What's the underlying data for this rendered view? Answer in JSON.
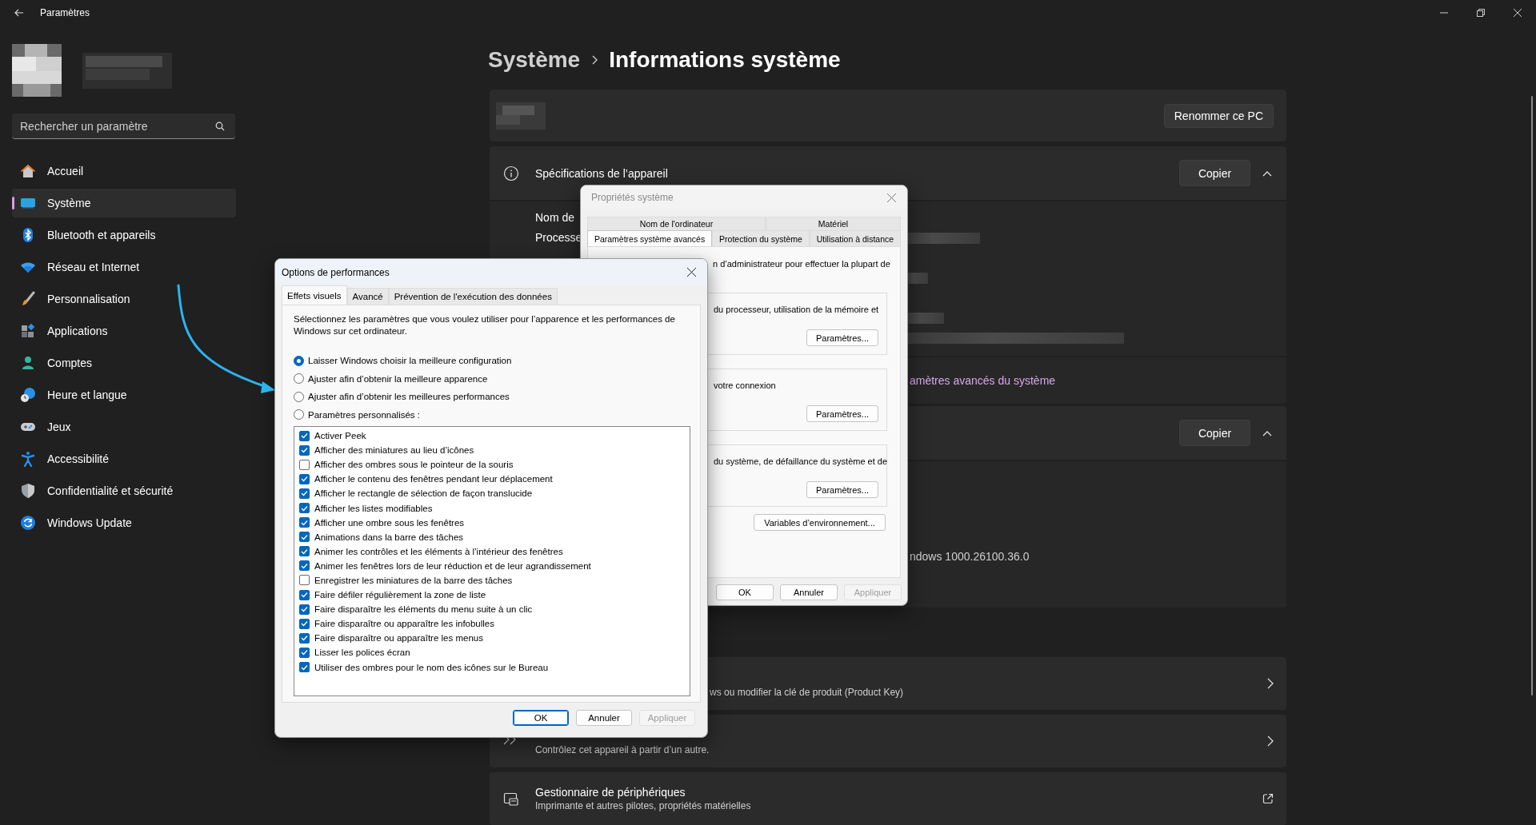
{
  "window": {
    "title": "Paramètres"
  },
  "sidebar": {
    "search": {
      "placeholder": "Rechercher un paramètre"
    },
    "items": [
      {
        "label": "Accueil",
        "selected": false
      },
      {
        "label": "Système",
        "selected": true
      },
      {
        "label": "Bluetooth et appareils",
        "selected": false
      },
      {
        "label": "Réseau et Internet",
        "selected": false
      },
      {
        "label": "Personnalisation",
        "selected": false
      },
      {
        "label": "Applications",
        "selected": false
      },
      {
        "label": "Comptes",
        "selected": false
      },
      {
        "label": "Heure et langue",
        "selected": false
      },
      {
        "label": "Jeux",
        "selected": false
      },
      {
        "label": "Accessibilité",
        "selected": false
      },
      {
        "label": "Confidentialité et sécurité",
        "selected": false
      },
      {
        "label": "Windows Update",
        "selected": false
      }
    ]
  },
  "page": {
    "breadcrumb": [
      "Système",
      "Informations système"
    ],
    "rename_button": "Renommer ce PC",
    "device_specs": {
      "title": "Spécifications de l’appareil",
      "copy_button": "Copier",
      "expanded": true,
      "rows": [
        "Nom de",
        "Processe"
      ],
      "link": "amètres avancés du système"
    },
    "windows_specs": {
      "copy_button": "Copier",
      "expanded": true,
      "version": "ndows 1000.26100.36.0"
    },
    "related": [
      {
        "kind": "chevron",
        "subtitle": "ws ou modifier la clé de produit (Product Key)"
      },
      {
        "kind": "chevron",
        "subtitle": "Contrôlez cet appareil à partir d’un autre."
      },
      {
        "kind": "external",
        "title": "Gestionnaire de périphériques",
        "subtitle": "Imprimante et autres pilotes, propriétés matérielles"
      }
    ]
  },
  "system_properties": {
    "title": "Propriétés système",
    "tab_rows": [
      [
        {
          "label": "Nom de l'ordinateur",
          "selected": false
        },
        {
          "label": "Matériel",
          "selected": false
        }
      ],
      [
        {
          "label": "Paramètres système avancés",
          "selected": true
        },
        {
          "label": "Protection du système",
          "selected": false
        },
        {
          "label": "Utilisation à distance",
          "selected": false
        }
      ]
    ],
    "intro": "n d’administrateur pour effectuer la plupart de",
    "groups": [
      {
        "text": "du processeur, utilisation de la mémoire et",
        "button": "Paramètres..."
      },
      {
        "text": "votre connexion",
        "button": "Paramètres..."
      },
      {
        "text": "du système, de défaillance du système et de",
        "button": "Paramètres..."
      }
    ],
    "env_button": "Variables d’environnement...",
    "buttons": [
      {
        "label": "OK",
        "default": false,
        "disabled": false
      },
      {
        "label": "Annuler",
        "default": false,
        "disabled": false
      },
      {
        "label": "Appliquer",
        "default": false,
        "disabled": true
      }
    ]
  },
  "performance_options": {
    "title": "Options de performances",
    "tabs": [
      {
        "label": "Effets visuels",
        "selected": true
      },
      {
        "label": "Avancé",
        "selected": false
      },
      {
        "label": "Prévention de l'exécution des données",
        "selected": false
      }
    ],
    "description": "Sélectionnez les paramètres que vous voulez utiliser pour l’apparence et les performances de Windows sur cet ordinateur.",
    "options": [
      {
        "label": "Laisser Windows choisir la meilleure configuration",
        "selected": true
      },
      {
        "label": "Ajuster afin d’obtenir la meilleure apparence",
        "selected": false
      },
      {
        "label": "Ajuster afin d’obtenir les meilleures performances",
        "selected": false
      },
      {
        "label": "Paramètres personnalisés :",
        "selected": false
      }
    ],
    "effects": [
      {
        "label": "Activer Peek",
        "checked": true
      },
      {
        "label": "Afficher des miniatures au lieu d’icônes",
        "checked": true
      },
      {
        "label": "Afficher des ombres sous le pointeur de la souris",
        "checked": false
      },
      {
        "label": "Afficher le contenu des fenêtres pendant leur déplacement",
        "checked": true
      },
      {
        "label": "Afficher le rectangle de sélection de façon translucide",
        "checked": true
      },
      {
        "label": "Afficher les listes modifiables",
        "checked": true
      },
      {
        "label": "Afficher une ombre sous les fenêtres",
        "checked": true
      },
      {
        "label": "Animations dans la barre des tâches",
        "checked": true
      },
      {
        "label": "Animer les contrôles et les éléments à l’intérieur des fenêtres",
        "checked": true
      },
      {
        "label": "Animer les fenêtres lors de leur réduction et de leur agrandissement",
        "checked": true
      },
      {
        "label": "Enregistrer les miniatures de la barre des tâches",
        "checked": false
      },
      {
        "label": "Faire défiler régulièrement la zone de liste",
        "checked": true
      },
      {
        "label": "Faire disparaître les éléments du menu suite à un clic",
        "checked": true
      },
      {
        "label": "Faire disparaître ou apparaître les infobulles",
        "checked": true
      },
      {
        "label": "Faire disparaître ou apparaître les menus",
        "checked": true
      },
      {
        "label": "Lisser les polices écran",
        "checked": true
      },
      {
        "label": "Utiliser des ombres pour le nom des icônes sur le Bureau",
        "checked": true
      }
    ],
    "buttons": [
      {
        "label": "OK",
        "default": true,
        "disabled": false
      },
      {
        "label": "Annuler",
        "default": false,
        "disabled": false
      },
      {
        "label": "Appliquer",
        "default": false,
        "disabled": true
      }
    ]
  }
}
